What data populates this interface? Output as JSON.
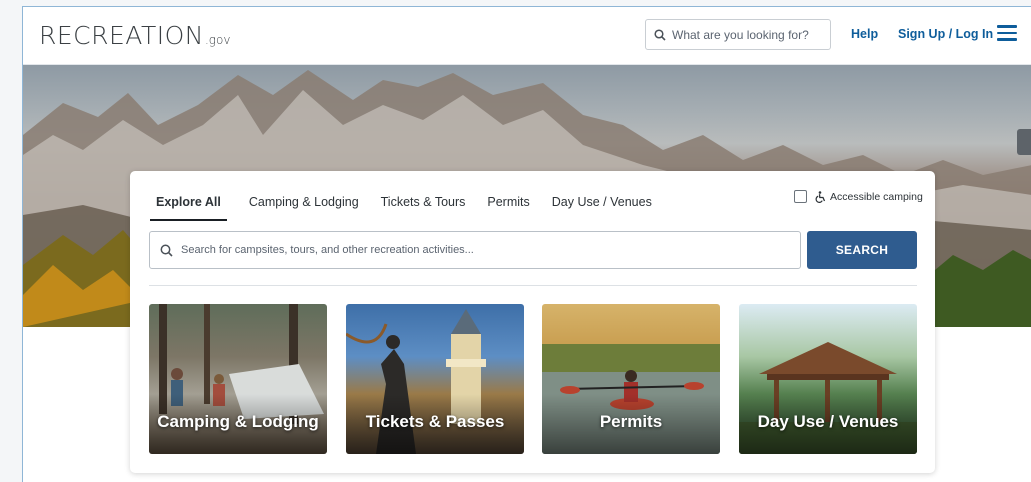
{
  "header": {
    "logo_text": "RECREATION",
    "logo_suffix": ".gov",
    "search_placeholder": "What are you looking for?",
    "help_label": "Help",
    "signup_label": "Sign Up / Log In"
  },
  "search_card": {
    "tabs": [
      {
        "label": "Explore All",
        "active": true
      },
      {
        "label": "Camping & Lodging",
        "active": false
      },
      {
        "label": "Tickets & Tours",
        "active": false
      },
      {
        "label": "Permits",
        "active": false
      },
      {
        "label": "Day Use / Venues",
        "active": false
      }
    ],
    "accessible_label": "Accessible camping",
    "search_placeholder": "Search for campsites, tours, and other recreation activities...",
    "search_button": "SEARCH"
  },
  "tiles": [
    {
      "label": "Camping & Lodging"
    },
    {
      "label": "Tickets & Passes"
    },
    {
      "label": "Permits"
    },
    {
      "label": "Day Use / Venues"
    }
  ],
  "colors": {
    "accent": "#0e5d9b",
    "search_button": "#2f5c8f"
  }
}
